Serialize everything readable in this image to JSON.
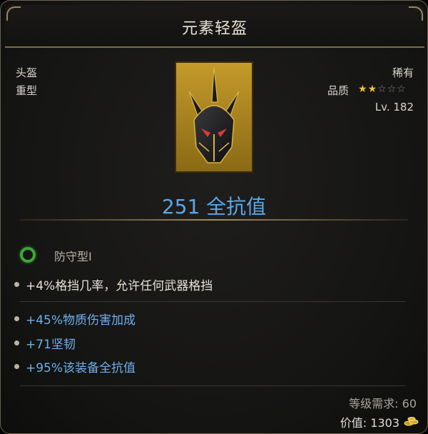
{
  "item": {
    "name": "元素轻盔",
    "slot": "头盔",
    "weight_class": "重型",
    "rarity": "稀有",
    "quality_label": "品质",
    "quality_stars": 2,
    "quality_max": 5,
    "level": "Lv. 182",
    "resistance": "251 全抗值",
    "set_name": "防守型I",
    "innate_affix": "+4%格挡几率，允许任何武器格挡",
    "affixes": [
      "+45%物质伤害加成",
      "+71坚韧",
      "+95%该装备全抗值"
    ],
    "requirement": "等级需求: 60",
    "value": "价值: 1303"
  },
  "colors": {
    "affix_blue": "#6fb0ec",
    "resist_blue": "#5aa8ea",
    "star_gold": "#f0c33a",
    "ring_green": "#3fa63a"
  },
  "icons": {
    "portrait": "dark-spiked-helmet-icon",
    "set": "green-ring-icon",
    "currency": "gold-coins-icon"
  }
}
